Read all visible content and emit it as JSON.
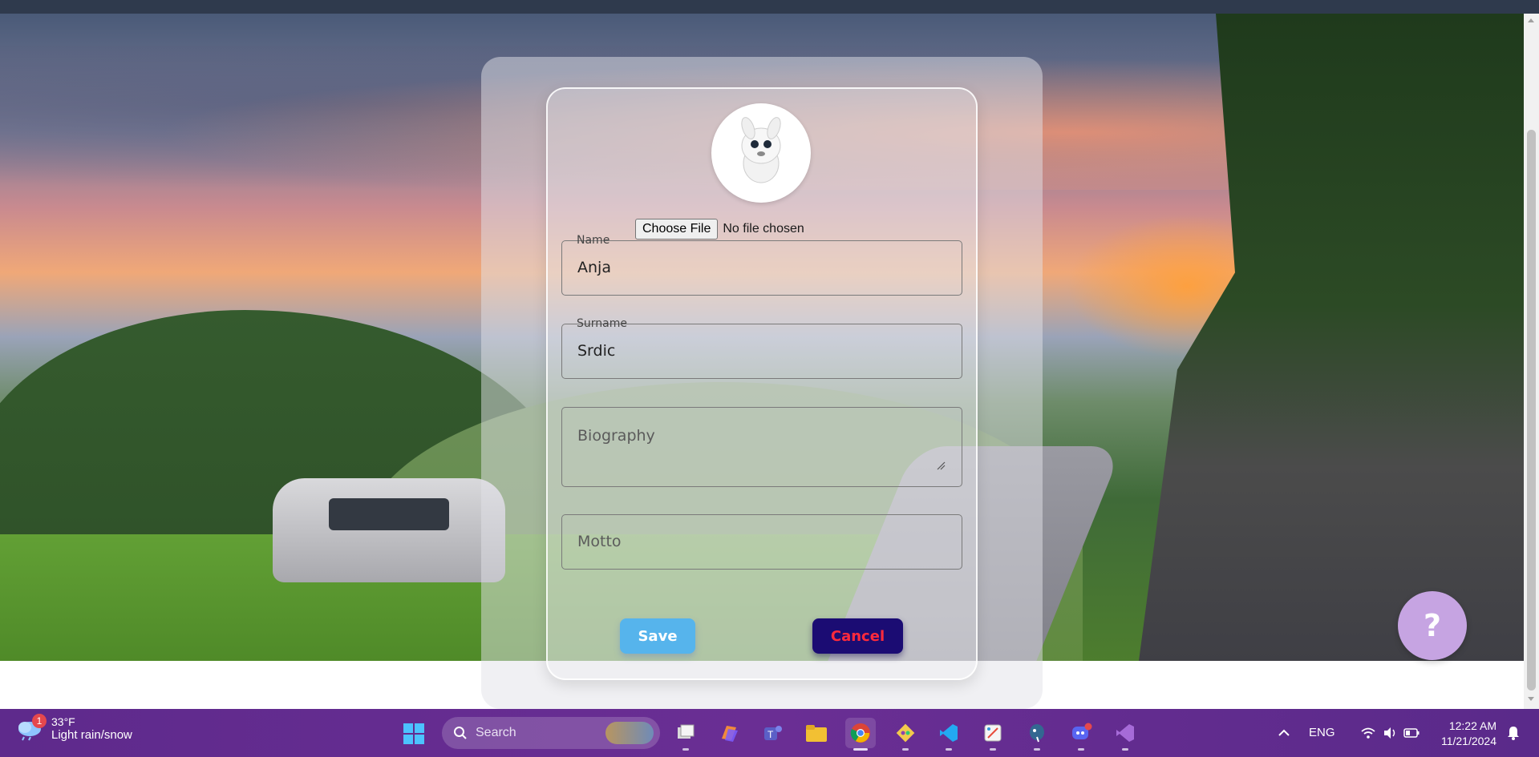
{
  "form": {
    "file_button_label": "Choose File",
    "file_status": "No file chosen",
    "name": {
      "label": "Name",
      "value": "Anja"
    },
    "surname": {
      "label": "Surname",
      "value": "Srdic"
    },
    "biography": {
      "placeholder": "Biography"
    },
    "motto": {
      "placeholder": "Motto"
    },
    "save_label": "Save",
    "cancel_label": "Cancel"
  },
  "help": {
    "label": "?"
  },
  "taskbar": {
    "weather": {
      "badge": "1",
      "temperature": "33°F",
      "condition": "Light rain/snow"
    },
    "search_label": "Search",
    "language": "ENG",
    "time": "12:22 AM",
    "date": "11/21/2024"
  },
  "colors": {
    "save_bg": "#56b4ec",
    "cancel_bg": "#1b0c73",
    "cancel_text": "#ff2a3c",
    "help_bg": "#c6a4e2",
    "taskbar_bg": "#6a2e94"
  },
  "icons": {
    "avatar": "bunny-avatar-icon",
    "start": "windows-start-icon",
    "search": "search-icon",
    "apps": [
      "task-view-icon",
      "copilot-icon",
      "teams-icon",
      "file-explorer-icon",
      "chrome-icon",
      "git-icon",
      "vscode-icon",
      "snipping-tool-icon",
      "postgres-icon",
      "discord-icon",
      "visual-studio-icon"
    ]
  }
}
